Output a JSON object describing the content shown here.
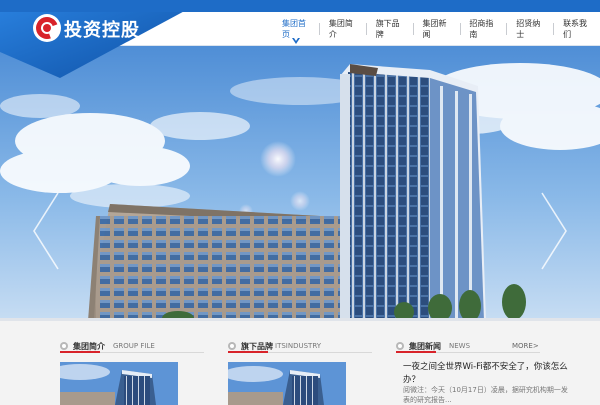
{
  "header": {
    "logo_text": "投资控股",
    "nav": [
      {
        "label": "集团首页",
        "active": true
      },
      {
        "label": "集团简介",
        "active": false
      },
      {
        "label": "旗下品牌",
        "active": false
      },
      {
        "label": "集团新闻",
        "active": false
      },
      {
        "label": "招商指南",
        "active": false
      },
      {
        "label": "招贤纳士",
        "active": false
      },
      {
        "label": "联系我们",
        "active": false
      }
    ]
  },
  "colors": {
    "brand_blue": "#1e6cc7",
    "accent_red": "#d8232a"
  },
  "sections": {
    "intro": {
      "title_cn": "集团简介",
      "title_en": "GROUP FILE"
    },
    "brands": {
      "title_cn": "旗下品牌",
      "title_en": "ITSINDUSTRY"
    },
    "news": {
      "title_cn": "集团新闻",
      "title_en": "NEWS",
      "more": "MORE>",
      "headline": "一夜之间全世界Wi-Fi都不安全了，你该怎么办？",
      "summary": "阅微注：今天（10月17日）凌晨，据研究机构期一发表的研究报告..."
    }
  },
  "icons": {
    "slider_prev": "chevron-left-icon",
    "slider_next": "chevron-right-icon",
    "section_marker": "circle-dot-icon"
  }
}
